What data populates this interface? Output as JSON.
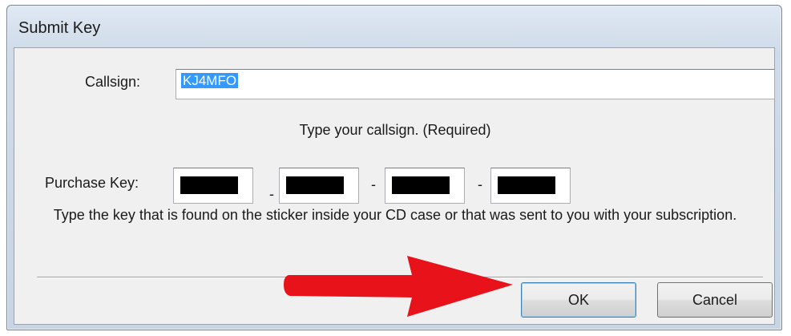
{
  "window": {
    "title": "Submit Key"
  },
  "callsign": {
    "label": "Callsign:",
    "value": "KJ4MFO",
    "hint": "Type your callsign. (Required)"
  },
  "purchase_key": {
    "label": "Purchase Key:",
    "separator": "-",
    "segments": [
      "",
      "",
      "",
      ""
    ],
    "hint": "Type the key that is found on the sticker inside your CD case or that was sent to you with your subscription."
  },
  "buttons": {
    "ok": "OK",
    "cancel": "Cancel"
  },
  "annotation": {
    "arrow_color": "#e8121a"
  }
}
